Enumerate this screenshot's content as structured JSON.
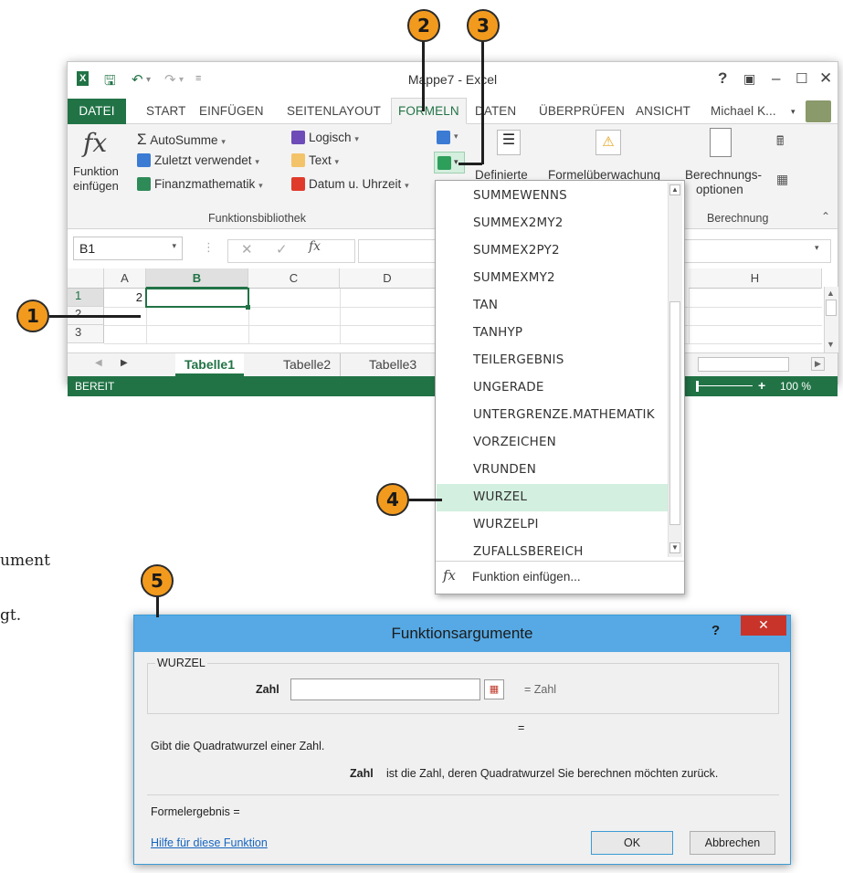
{
  "excel": {
    "title": "Mappe7 - Excel",
    "help": "?",
    "tabs": [
      "DATEI",
      "START",
      "EINFÜGEN",
      "SEITENLAYOUT",
      "FORMELN",
      "DATEN",
      "ÜBERPRÜFEN",
      "ANSICHT"
    ],
    "active_tab": "FORMELN",
    "user": "Michael K...",
    "ribbon": {
      "insert_function_l1": "Funktion",
      "insert_function_l2": "einfügen",
      "autosum": "AutoSumme",
      "recent": "Zuletzt verwendet",
      "financial": "Finanzmathematik",
      "logical": "Logisch",
      "text": "Text",
      "datetime": "Datum u. Uhrzeit",
      "defined": "Definierte",
      "audit": "Formelüberwachung",
      "calc_l1": "Berechnungs-",
      "calc_l2": "optionen",
      "group_library": "Funktionsbibliothek",
      "group_calc": "Berechnung"
    },
    "formula": {
      "namebox": "B1",
      "fx": "fx"
    },
    "columns": [
      "A",
      "B",
      "C",
      "D",
      "H"
    ],
    "rows": [
      "1",
      "2",
      "3"
    ],
    "cell_a1": "2",
    "sheets": [
      "Tabelle1",
      "Tabelle2",
      "Tabelle3"
    ],
    "status": "BEREIT",
    "zoom": "100 %"
  },
  "dropdown": {
    "items": [
      "SUMMEWENNS",
      "SUMMEX2MY2",
      "SUMMEX2PY2",
      "SUMMEXMY2",
      "TAN",
      "TANHYP",
      "TEILERGEBNIS",
      "UNGERADE",
      "UNTERGRENZE.MATHEMATIK",
      "VORZEICHEN",
      "VRUNDEN",
      "WURZEL",
      "WURZELPI",
      "ZUFALLSBEREICH"
    ],
    "selected": "WURZEL",
    "footer": "Funktion einfügen..."
  },
  "dialog": {
    "title": "Funktionsargumente",
    "function": "WURZEL",
    "arg_label": "Zahl",
    "arg_value": "",
    "arg_result": "= Zahl",
    "eq": "=",
    "description": "Gibt die Quadratwurzel einer Zahl.",
    "arg_name": "Zahl",
    "arg_desc": "ist die Zahl, deren Quadratwurzel Sie berechnen möchten zurück.",
    "result": "Formelergebnis =",
    "help_link": "Hilfe für diese Funktion",
    "ok": "OK",
    "cancel": "Abbrechen"
  },
  "callouts": [
    "1",
    "2",
    "3",
    "4",
    "5"
  ],
  "side_text": [
    "ument",
    "gt."
  ],
  "colors": {
    "excel_green": "#217346",
    "callout_orange": "#f29a1d",
    "dialog_blue": "#56a9e4",
    "selected_row": "#d3efe0"
  }
}
